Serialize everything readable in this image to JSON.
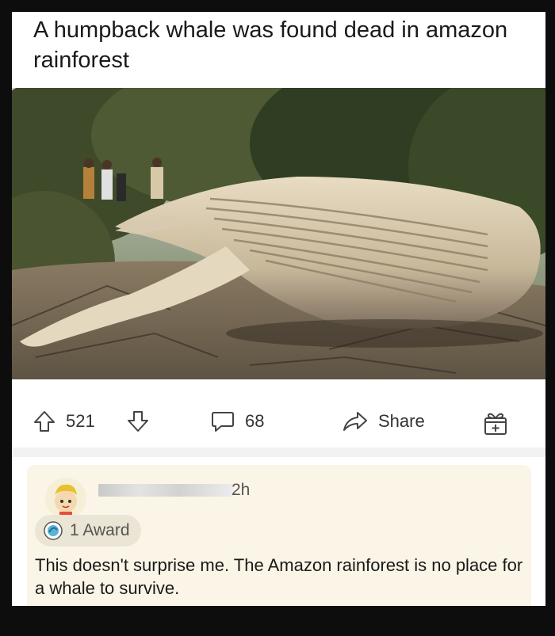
{
  "post": {
    "title": "A humpback whale was found dead in amazon rainforest"
  },
  "image": {
    "description_icon": "photo-image"
  },
  "actions": {
    "upvote_count": "521",
    "comment_count": "68",
    "share_label": "Share"
  },
  "comment": {
    "time": "2h",
    "award_label": "1 Award",
    "text": "This doesn't surprise me. The Amazon rainforest is no place for a whale to survive."
  },
  "colors": {
    "background": "#0d0d0d",
    "card": "#ffffff",
    "comment_bg": "#faf5e6",
    "award_bg": "#eae5d4"
  }
}
